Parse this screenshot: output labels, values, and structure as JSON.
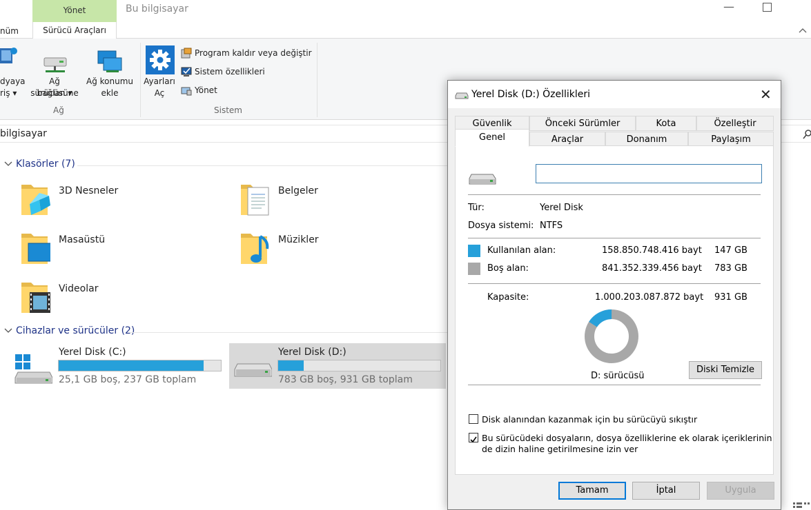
{
  "titlebar": {
    "context_tab": "Yönet",
    "title": "Bu bilgisayar"
  },
  "ribbon": {
    "tabs": [
      "nüm",
      "Sürücü Araçları"
    ],
    "buttons": {
      "media_l1": "dyaya",
      "media_l2": "riş",
      "map_drive_l1": "Ağ sürücüsüne",
      "map_drive_l2": "bağlan",
      "net_loc_l1": "Ağ konumu",
      "net_loc_l2": "ekle",
      "settings_l1": "Ayarları",
      "settings_l2": "Aç"
    },
    "small_commands": [
      "Program kaldır veya değiştir",
      "Sistem özellikleri",
      "Yönet"
    ],
    "groups": [
      "Ağ",
      "Sistem"
    ]
  },
  "address": {
    "path": "bilgisayar"
  },
  "content": {
    "folders_header": "Klasörler (7)",
    "folders": [
      "3D Nesneler",
      "Belgeler",
      "Masaüstü",
      "Müzikler",
      "Videolar"
    ],
    "devices_header": "Cihazlar ve sürücüler (2)",
    "drives": [
      {
        "name": "Yerel Disk (C:)",
        "summary": "25,1 GB boş, 237 GB toplam",
        "used_fraction": 0.894
      },
      {
        "name": "Yerel Disk (D:)",
        "summary": "783 GB boş, 931 GB toplam",
        "used_fraction": 0.158
      }
    ]
  },
  "dialog": {
    "title": "Yerel Disk (D:) Özellikleri",
    "tabs_row1": [
      "Güvenlik",
      "Önceki Sürümler",
      "Kota",
      "Özelleştir"
    ],
    "tabs_row2": [
      "Genel",
      "Araçlar",
      "Donanım",
      "Paylaşım"
    ],
    "name_value": "",
    "type_label": "Tür:",
    "type_value": "Yerel Disk",
    "fs_label": "Dosya sistemi:",
    "fs_value": "NTFS",
    "used_label": "Kullanılan alan:",
    "used_bytes": "158.850.748.416 bayt",
    "used_gb": "147 GB",
    "free_label": "Boş alan:",
    "free_bytes": "841.352.339.456 bayt",
    "free_gb": "783 GB",
    "capacity_label": "Kapasite:",
    "capacity_bytes": "1.000.203.087.872 bayt",
    "capacity_gb": "931 GB",
    "used_fraction": 0.1588,
    "drive_label": "D: sürücüsü",
    "cleanup_button": "Diski Temizle",
    "compress_label": "Disk alanından kazanmak için bu sürücüyü sıkıştır",
    "compress_checked": false,
    "index_label_l1": "Bu sürücüdeki dosyaların, dosya özelliklerine ek olarak içeriklerinin",
    "index_label_l2": "de dizin haline getirilmesine izin ver",
    "index_checked": true,
    "ok": "Tamam",
    "cancel": "İptal",
    "apply": "Uygula"
  },
  "colors": {
    "used": "#26a0da",
    "free": "#a8a8a8",
    "context_tab": "#c7e6a8",
    "group_header": "#1e3287"
  }
}
